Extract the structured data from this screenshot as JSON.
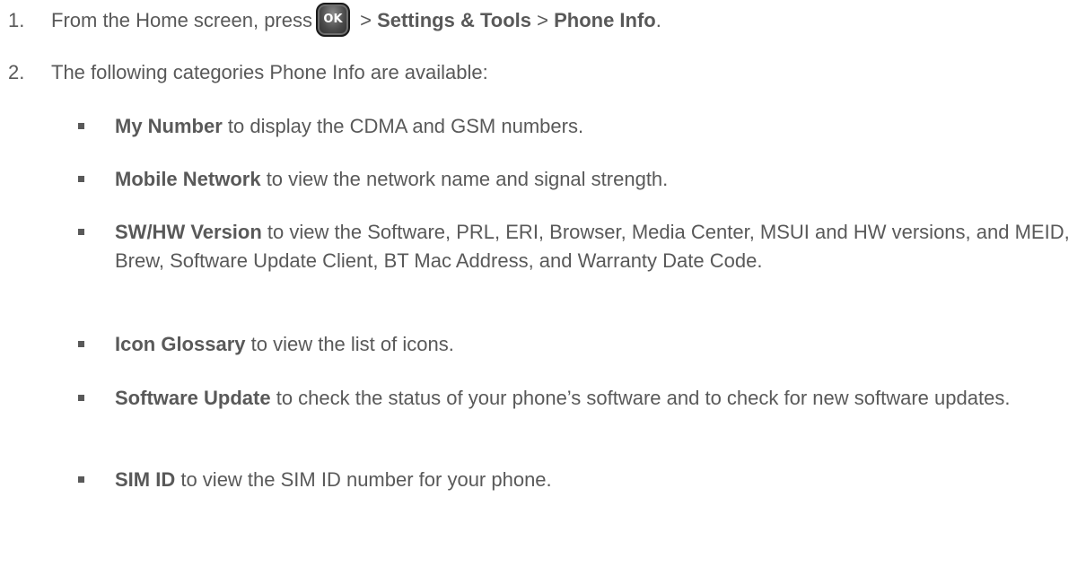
{
  "steps": [
    {
      "number": "1.",
      "prefix": "From the Home screen, press",
      "key_label": "OK",
      "sep1": " > ",
      "path1": "Settings & Tools",
      "sep2": " > ",
      "path2": "Phone Info",
      "suffix": "."
    },
    {
      "number": "2.",
      "text": "The following categories Phone Info are available:"
    }
  ],
  "bullets": [
    {
      "term": "My Number",
      "desc": " to display the CDMA and GSM numbers."
    },
    {
      "term": "Mobile Network",
      "desc": " to view the network name and signal strength."
    },
    {
      "term": "SW/HW Version",
      "desc": " to view the Software, PRL, ERI, Browser, Media Center, MSUI and HW versions, and MEID, Brew, Software Update Client, BT Mac Address, and Warranty Date Code."
    },
    {
      "term": "Icon Glossary",
      "desc": " to view the list of icons."
    },
    {
      "term": "Software Update",
      "desc": " to check the status of your phone’s software and to check for new software updates."
    },
    {
      "term": "SIM ID",
      "desc": " to view the SIM ID number for your phone."
    }
  ],
  "colors": {
    "text": "#595959",
    "key_background": "#4a4a4a"
  },
  "icons": {
    "ok_key": "ok-key-icon"
  }
}
